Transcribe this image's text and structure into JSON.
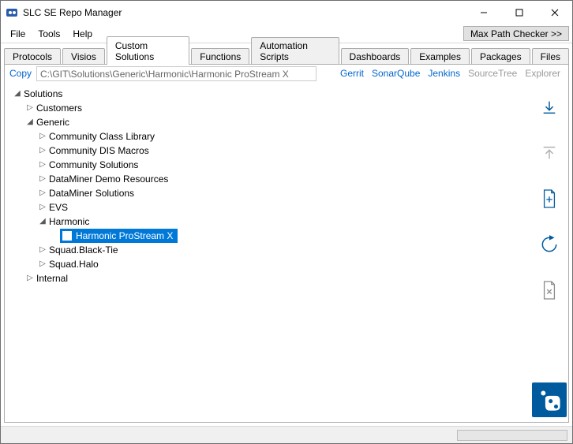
{
  "window": {
    "title": "SLC SE Repo Manager"
  },
  "menu": {
    "file": "File",
    "tools": "Tools",
    "help": "Help",
    "maxpath": "Max Path Checker >>"
  },
  "tabs": {
    "protocols": "Protocols",
    "visios": "Visios",
    "custom": "Custom Solutions",
    "functions": "Functions",
    "automation": "Automation Scripts",
    "dashboards": "Dashboards",
    "examples": "Examples",
    "packages": "Packages",
    "files": "Files"
  },
  "path": {
    "copy": "Copy",
    "value": "C:\\GIT\\Solutions\\Generic\\Harmonic\\Harmonic ProStream X"
  },
  "links": {
    "gerrit": "Gerrit",
    "sonar": "SonarQube",
    "jenkins": "Jenkins",
    "sourcetree": "SourceTree",
    "explorer": "Explorer"
  },
  "tree": {
    "root": "Solutions",
    "customers": "Customers",
    "generic": "Generic",
    "ccl": "Community Class Library",
    "cdm": "Community DIS Macros",
    "cs": "Community Solutions",
    "ddr": "DataMiner Demo Resources",
    "ds": "DataMiner Solutions",
    "evs": "EVS",
    "harmonic": "Harmonic",
    "hpx": "Harmonic ProStream X",
    "sbt": "Squad.Black-Tie",
    "sh": "Squad.Halo",
    "internal": "Internal"
  }
}
